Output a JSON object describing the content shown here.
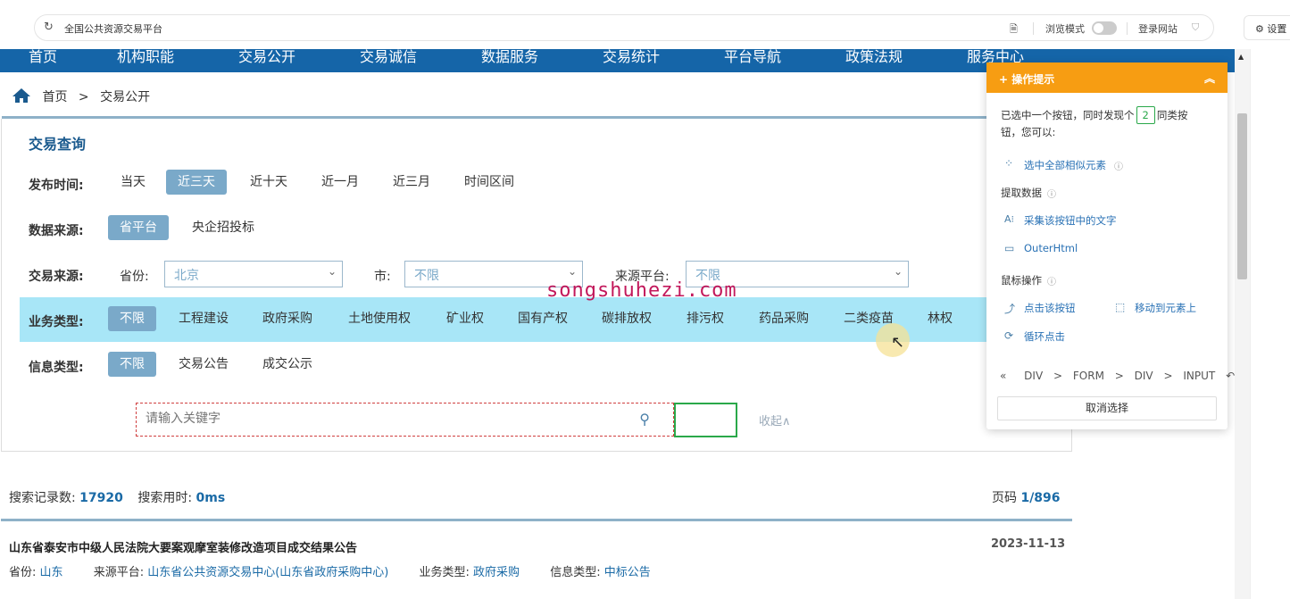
{
  "browser": {
    "url": "全国公共资源交易平台",
    "browse_mode": "浏览模式",
    "login_site": "登录网站",
    "settings": "设置"
  },
  "nav": [
    "首页",
    "机构职能",
    "交易公开",
    "交易诚信",
    "数据服务",
    "交易统计",
    "平台导航",
    "政策法规",
    "服务中心"
  ],
  "breadcrumb": {
    "home": "首页",
    "sep": ">",
    "current": "交易公开"
  },
  "query": {
    "title": "交易查询",
    "time_label": "发布时间:",
    "time_options": [
      "当天",
      "近三天",
      "近十天",
      "近一月",
      "近三月",
      "时间区间"
    ],
    "time_selected": "近三天",
    "source_label": "数据来源:",
    "source_options": [
      "省平台",
      "央企招投标"
    ],
    "trade_label": "交易来源:",
    "province_label": "省份:",
    "province_value": "北京",
    "city_label": "市:",
    "city_value": "不限",
    "platform_label": "来源平台:",
    "platform_value": "不限",
    "biz_label": "业务类型:",
    "biz_options": [
      "不限",
      "工程建设",
      "政府采购",
      "土地使用权",
      "矿业权",
      "国有产权",
      "碳排放权",
      "排污权",
      "药品采购",
      "二类疫苗",
      "林权"
    ],
    "info_label": "信息类型:",
    "info_options": [
      "不限",
      "交易公告",
      "成交公示"
    ],
    "search_placeholder": "请输入关键字",
    "collapse": "收起∧"
  },
  "watermark": "songshuhezi.com",
  "results": {
    "count_label": "搜索记录数:",
    "count": "17920",
    "time_label": "搜索用时:",
    "time": "0ms",
    "page_label": "页码",
    "page": "1/896",
    "items": [
      {
        "title": "山东省泰安市中级人民法院大要案观摩室装修改造项目成交结果公告",
        "date": "2023-11-13",
        "province_label": "省份:",
        "province": "山东",
        "platform_label": "来源平台:",
        "platform": "山东省公共资源交易中心(山东省政府采购中心)",
        "biz_label": "业务类型:",
        "biz": "政府采购",
        "info_label": "信息类型:",
        "info": "中标公告"
      }
    ]
  },
  "popup": {
    "title": "操作提示",
    "intro_a": "已选中一个按钮，同时发现个",
    "count": "2",
    "intro_b": "同类按",
    "intro_c": "钮，您可以:",
    "select_all": "选中全部相似元素",
    "extract_label": "提取数据",
    "collect_text": "采集该按钮中的文字",
    "outer_html": "OuterHtml",
    "mouse_label": "鼠标操作",
    "click_button": "点击该按钮",
    "move_to": "移动到元素上",
    "loop_click": "循环点击",
    "path": [
      "DIV",
      "FORM",
      "DIV",
      "INPUT"
    ],
    "cancel": "取消选择"
  }
}
